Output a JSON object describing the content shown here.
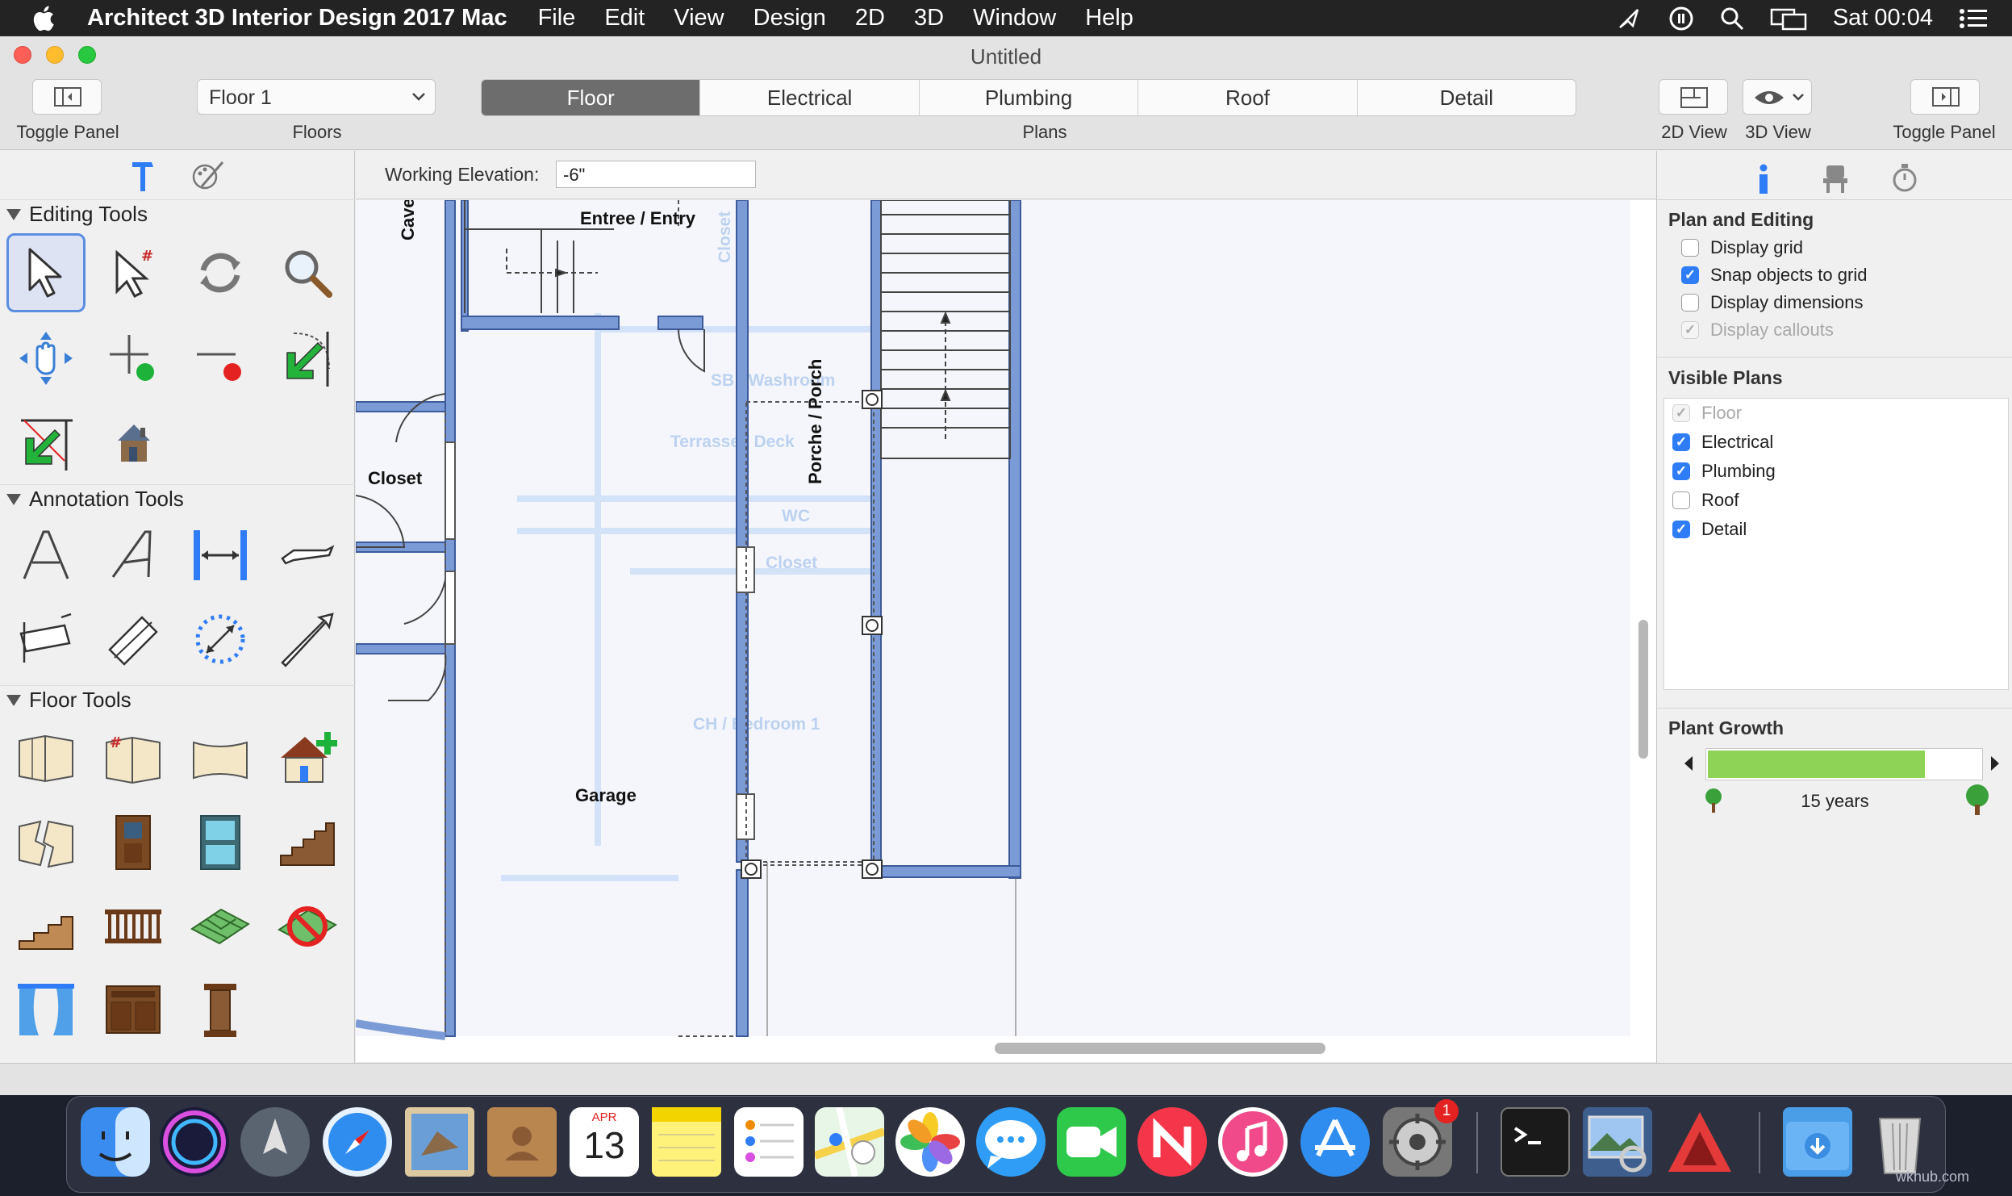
{
  "menubar": {
    "app_name": "Architect 3D Interior Design 2017 Mac",
    "items": [
      "File",
      "Edit",
      "View",
      "Design",
      "2D",
      "3D",
      "Window",
      "Help"
    ],
    "clock": "Sat 00:04"
  },
  "window": {
    "title": "Untitled"
  },
  "toolbar": {
    "toggle_left_label": "Toggle Panel",
    "floor_select_value": "Floor 1",
    "floors_label": "Floors",
    "plans_label": "Plans",
    "plans_tabs": [
      "Floor",
      "Electrical",
      "Plumbing",
      "Roof",
      "Detail"
    ],
    "active_plan": "Floor",
    "view2d_label": "2D View",
    "view3d_label": "3D View",
    "toggle_right_label": "Toggle Panel"
  },
  "left_panel": {
    "editing_tools_title": "Editing Tools",
    "annotation_tools_title": "Annotation Tools",
    "floor_tools_title": "Floor Tools"
  },
  "canvas": {
    "working_elevation_label": "Working Elevation:",
    "working_elevation_value": "-6\"",
    "rooms": {
      "cave": "Cave",
      "entry": "Entree / Entry",
      "closet": "Closet",
      "porch": "Porche / Porch",
      "garage": "Garage",
      "washroom": "SB / Washroom",
      "terrasse": "Terrasse / Deck",
      "wc": "WC",
      "closet2": "Closet",
      "closet3": "Closet",
      "bedroom": "CH / Bedroom 1"
    }
  },
  "right_panel": {
    "plan_editing_title": "Plan and Editing",
    "plan_options": [
      {
        "label": "Display grid",
        "checked": false,
        "disabled": false
      },
      {
        "label": "Snap objects to grid",
        "checked": true,
        "disabled": false
      },
      {
        "label": "Display dimensions",
        "checked": false,
        "disabled": false
      },
      {
        "label": "Display callouts",
        "checked": true,
        "disabled": true
      }
    ],
    "visible_plans_title": "Visible Plans",
    "visible_plans": [
      {
        "label": "Floor",
        "checked": true,
        "disabled": true
      },
      {
        "label": "Electrical",
        "checked": true,
        "disabled": false
      },
      {
        "label": "Plumbing",
        "checked": true,
        "disabled": false
      },
      {
        "label": "Roof",
        "checked": false,
        "disabled": false
      },
      {
        "label": "Detail",
        "checked": true,
        "disabled": false
      }
    ],
    "plant_growth_title": "Plant Growth",
    "plant_growth_value": "15 years",
    "plant_growth_fraction": 0.79
  },
  "dock": {
    "calendar_month": "APR",
    "calendar_day": "13",
    "badge_count": "1",
    "watermark": "wkhub.com"
  },
  "colors": {
    "accent": "#2f7df6",
    "wall": "#7b9bd6",
    "growth_fill": "#8fd356"
  }
}
